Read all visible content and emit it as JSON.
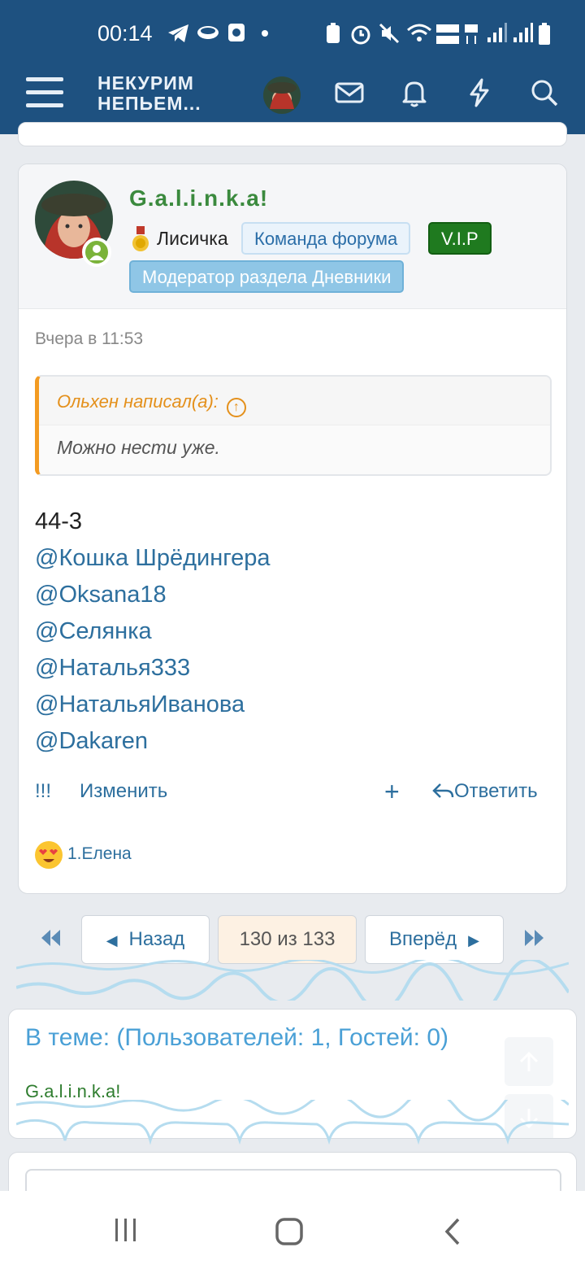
{
  "status_bar": {
    "time": "00:14"
  },
  "header": {
    "logo_line1": "НЕКУРИМ",
    "logo_line2": "НЕПЬЕМ..."
  },
  "post": {
    "author": "G.a.l.i.n.k.a!",
    "rank": "Лисичка",
    "badges": {
      "team": "Команда форума",
      "vip": "V.I.P",
      "moderator": "Модератор раздела Дневники"
    },
    "date": "Вчера в 11:53",
    "quote": {
      "header": "Ольхен написал(а):",
      "text": "Можно нести уже."
    },
    "body_text": "44-3",
    "mentions": [
      "@Кошка Шрёдингера",
      "@Oksana18",
      "@Селянка",
      "@Наталья333",
      "@НатальяИванова",
      "@Dakaren"
    ],
    "actions": {
      "report": "!!!",
      "edit": "Изменить",
      "plus": "+",
      "reply": "Ответить"
    },
    "reaction_user": "1.Елена"
  },
  "pager": {
    "prev": "Назад",
    "current": "130 из 133",
    "next": "Вперёд"
  },
  "online": {
    "title": "В теме: (Пользователей: 1, Гостей: 0)",
    "user": "G.a.l.i.n.k.a!"
  },
  "colors": {
    "header_bg": "#1e5180",
    "link": "#2d6f9e",
    "author": "#3b8a3e",
    "quote_accent": "#f39b22",
    "vip": "#1f7a1f"
  }
}
